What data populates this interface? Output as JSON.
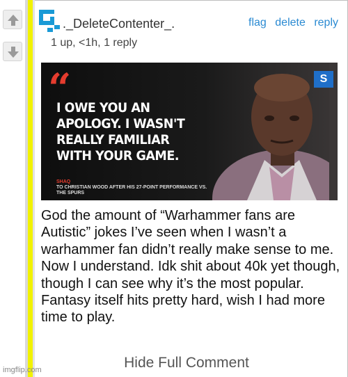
{
  "comment": {
    "username": "._DeleteContenter_.",
    "meta": "1 up, <1h, 1 reply",
    "actions": {
      "flag": "flag",
      "delete": "delete",
      "reply": "reply"
    },
    "body": "God the amount of “Warhammer fans are Autistic” jokes I’ve seen when I wasn’t a warhammer fan didn’t really make sense to me. Now I understand. Idk shit about 40k yet though, though I can see why it’s the most popular. Fantasy itself hits pretty hard, wish I had more time to play.",
    "hide_label": "Hide Full Comment"
  },
  "meme": {
    "quote": "I OWE YOU AN APOLOGY. I WASN'T REALLY FAMILIAR WITH YOUR GAME.",
    "credit_name": "SHAQ",
    "credit_line": "TO CHRISTIAN WOOD AFTER HIS 27-POINT PERFORMANCE VS. THE SPURS",
    "logo": "S"
  },
  "watermark": "imgflip.com",
  "colors": {
    "accent_link": "#2a8ad2",
    "stripe_yellow": "#f2f200",
    "meme_red": "#e53c2e"
  },
  "icons": {
    "upvote": "arrow-up-icon",
    "downvote": "arrow-down-icon",
    "avatar": "pixel-avatar-icon"
  }
}
